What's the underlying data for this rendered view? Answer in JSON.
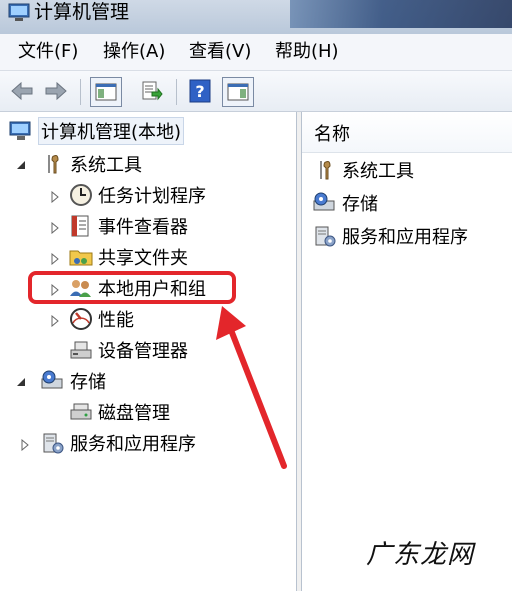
{
  "window": {
    "title": "计算机管理"
  },
  "menu": [
    "文件(F)",
    "操作(A)",
    "查看(V)",
    "帮助(H)"
  ],
  "toolbar": {
    "icons": [
      "back-arrow-icon",
      "forward-arrow-icon",
      "show-tree-icon",
      "export-list-icon",
      "help-icon",
      "action-pane-icon"
    ]
  },
  "tree": {
    "root": "计算机管理(本地)",
    "system_tools": "系统工具",
    "task_scheduler": "任务计划程序",
    "event_viewer": "事件查看器",
    "shared_folders": "共享文件夹",
    "local_users_groups": "本地用户和组",
    "performance": "性能",
    "device_manager": "设备管理器",
    "storage": "存储",
    "disk_management": "磁盘管理",
    "services_apps": "服务和应用程序"
  },
  "list": {
    "header": "名称",
    "items": [
      "系统工具",
      "存储",
      "服务和应用程序"
    ]
  },
  "annotation": {
    "color": "#e3262b"
  },
  "watermark": "广东龙网"
}
